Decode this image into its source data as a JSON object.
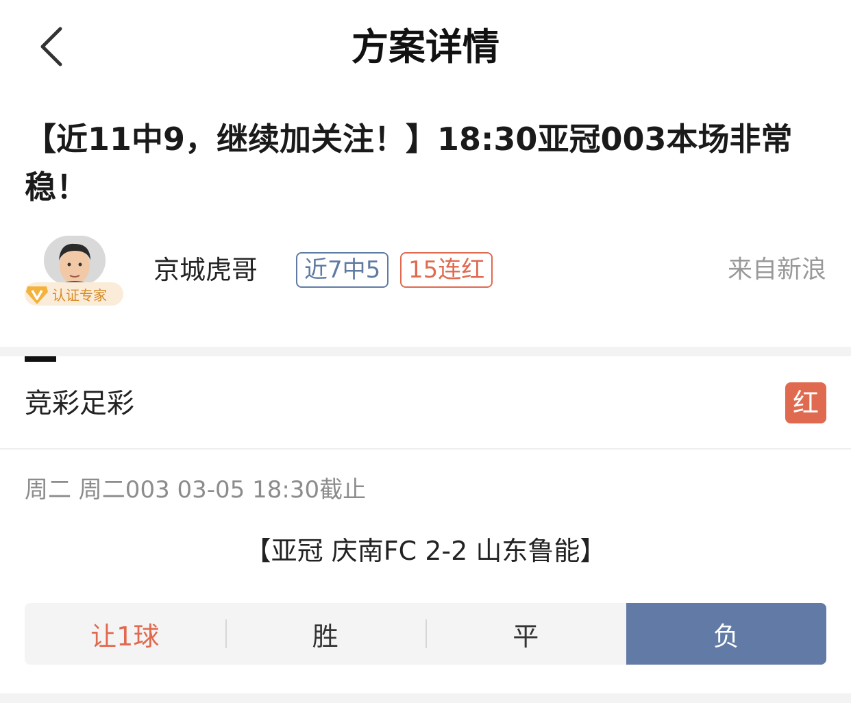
{
  "nav": {
    "title": "方案详情",
    "back_icon": "chevron-left-icon"
  },
  "headline": "【近11中9，继续加关注！】18:30亚冠003本场非常稳！",
  "author": {
    "name": "京城虎哥",
    "certification": "认证专家",
    "tags": [
      "近7中5",
      "15连红"
    ],
    "source": "来自新浪"
  },
  "category": {
    "title": "竞彩足彩",
    "result": "红"
  },
  "match": {
    "meta": "周二 周二003 03-05 18:30截止",
    "name": "【亚冠 庆南FC 2-2 山东鲁能】"
  },
  "options": {
    "handicap": "让1球",
    "win": "胜",
    "draw": "平",
    "lose": "负",
    "selected": "负"
  },
  "colors": {
    "accent_blue": "#617ba6",
    "accent_red": "#e06a4f",
    "cert_gold": "#d6891f"
  }
}
